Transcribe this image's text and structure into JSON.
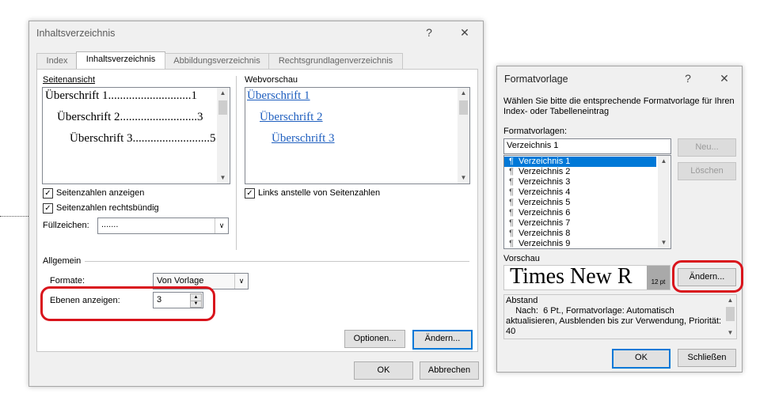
{
  "dialog1": {
    "title": "Inhaltsverzeichnis",
    "help": "?",
    "close": "✕",
    "tabs": [
      "Index",
      "Inhaltsverzeichnis",
      "Abbildungsverzeichnis",
      "Rechtsgrundlagenverzeichnis"
    ],
    "print_preview": {
      "label": "Seitenansicht",
      "entries": [
        {
          "text": "Überschrift 1............................1"
        },
        {
          "text": "Überschrift 2..........................3"
        },
        {
          "text": "Überschrift 3..........................5"
        }
      ]
    },
    "web_preview": {
      "label": "Webvorschau",
      "entries": [
        "Überschrift 1",
        "Überschrift 2",
        "Überschrift 3"
      ]
    },
    "options": {
      "show_page_numbers": {
        "label": "Seitenzahlen anzeigen",
        "checked": true
      },
      "right_align": {
        "label": "Seitenzahlen rechtsbündig",
        "checked": true
      },
      "use_links": {
        "label": "Links anstelle von Seitenzahlen",
        "checked": true
      },
      "fill_label": "Füllzeichen:",
      "fill_value": "......."
    },
    "general": {
      "label": "Allgemein",
      "formats_label": "Formate:",
      "formats_value": "Von Vorlage",
      "levels_label": "Ebenen anzeigen:",
      "levels_value": "3"
    },
    "buttons": {
      "options": "Optionen...",
      "modify": "Ändern...",
      "ok": "OK",
      "cancel": "Abbrechen"
    }
  },
  "dialog2": {
    "title": "Formatvorlage",
    "help": "?",
    "close": "✕",
    "instruction": "Wählen Sie bitte die entsprechende Formatvorlage für Ihren Index- oder Tabelleneintrag",
    "styles_label": "Formatvorlagen:",
    "style_input": "Verzeichnis 1",
    "styles": [
      "Verzeichnis 1",
      "Verzeichnis 2",
      "Verzeichnis 3",
      "Verzeichnis 4",
      "Verzeichnis 5",
      "Verzeichnis 6",
      "Verzeichnis 7",
      "Verzeichnis 8",
      "Verzeichnis 9"
    ],
    "selected_index": 0,
    "new_button": "Neu...",
    "delete_button": "Löschen",
    "preview_label": "Vorschau",
    "preview_text": "Times New R",
    "preview_size": "12 pt",
    "modify_button": "Ändern...",
    "description": "Abstand\n    Nach:  6 Pt., Formatvorlage: Automatisch aktualisieren, Ausblenden bis zur Verwendung, Priorität: 40",
    "ok": "OK",
    "close_button": "Schließen"
  },
  "colors": {
    "highlight_red": "#d9141c",
    "selection_blue": "#0078d7",
    "link_blue": "#1f5fbf"
  }
}
